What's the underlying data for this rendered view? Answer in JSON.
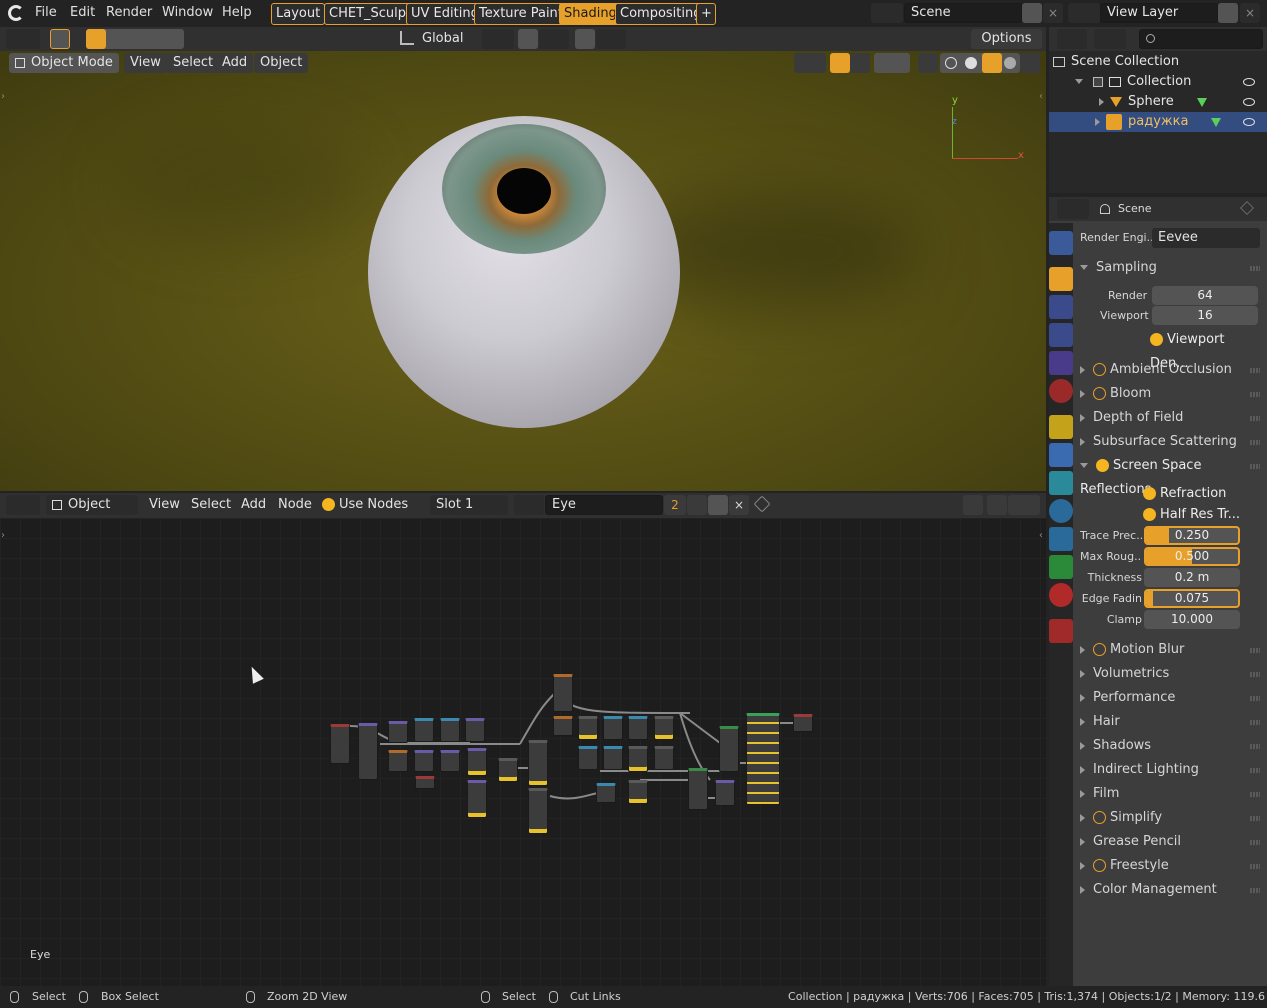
{
  "menus": [
    "File",
    "Edit",
    "Render",
    "Window",
    "Help"
  ],
  "workspaces": [
    {
      "label": "Layout"
    },
    {
      "label": "CHET_Sculpt"
    },
    {
      "label": "UV Editing"
    },
    {
      "label": "Texture Paint"
    },
    {
      "label": "Shading",
      "active": true
    },
    {
      "label": "Compositing"
    },
    {
      "label": "+"
    }
  ],
  "scene": {
    "name": "Scene"
  },
  "view_layer": {
    "name": "View Layer"
  },
  "viewport": {
    "transform_orientation": "Global",
    "options_label": "Options",
    "mode": "Object Mode",
    "menus": [
      "View",
      "Select",
      "Add",
      "Object"
    ],
    "gizmo": {
      "y": "y",
      "z": "z",
      "x": "x"
    }
  },
  "node_editor": {
    "type": "Object",
    "menus": [
      "View",
      "Select",
      "Add",
      "Node"
    ],
    "use_nodes_label": "Use Nodes",
    "slot": "Slot 1",
    "material": "Eye",
    "user_count": "2",
    "material_label": "Eye"
  },
  "outliner": {
    "root": "Scene Collection",
    "items": [
      {
        "label": "Collection"
      },
      {
        "label": "Sphere"
      },
      {
        "label": "радужка",
        "selected": true
      }
    ]
  },
  "properties": {
    "context": "Scene",
    "render_engine_label": "Render Engi...",
    "render_engine": "Eevee",
    "sampling": {
      "title": "Sampling",
      "render_label": "Render",
      "render": "64",
      "viewport_label": "Viewport",
      "viewport": "16",
      "denoise_label": "Viewport Den..."
    },
    "panels_a": [
      {
        "label": "Ambient Occlusion",
        "checkbox": true
      },
      {
        "label": "Bloom",
        "checkbox": true
      },
      {
        "label": "Depth of Field",
        "checkbox": false
      },
      {
        "label": "Subsurface Scattering",
        "checkbox": false
      }
    ],
    "ssr": {
      "title": "Screen Space Reflections",
      "refraction_label": "Refraction",
      "half_res_label": "Half Res Tr...",
      "fields": [
        {
          "label": "Trace Prec...",
          "value": "0.250",
          "fill": 0.25,
          "selected": true
        },
        {
          "label": "Max Roug...",
          "value": "0.500",
          "fill": 0.5,
          "selected": true
        },
        {
          "label": "Thickness",
          "value": "0.2 m",
          "fill": 0,
          "selected": false
        },
        {
          "label": "Edge Fadin",
          "value": "0.075",
          "fill": 0.075,
          "selected": true
        },
        {
          "label": "Clamp",
          "value": "10.000",
          "fill": 0,
          "selected": false
        }
      ]
    },
    "panels_b": [
      {
        "label": "Motion Blur",
        "checkbox": true
      },
      {
        "label": "Volumetrics",
        "checkbox": false
      },
      {
        "label": "Performance",
        "checkbox": false
      },
      {
        "label": "Hair",
        "checkbox": false
      },
      {
        "label": "Shadows",
        "checkbox": false
      },
      {
        "label": "Indirect Lighting",
        "checkbox": false
      },
      {
        "label": "Film",
        "checkbox": false
      },
      {
        "label": "Simplify",
        "checkbox": true
      },
      {
        "label": "Grease Pencil",
        "checkbox": false
      },
      {
        "label": "Freestyle",
        "checkbox": true
      },
      {
        "label": "Color Management",
        "checkbox": false
      }
    ]
  },
  "statusbar": {
    "select": "Select",
    "box_select": "Box Select",
    "zoom": "Zoom 2D View",
    "select2": "Select",
    "cut_links": "Cut Links",
    "stats": "Collection | радужка | Verts:706 | Faces:705 | Tris:1,374 | Objects:1/2 | Memory: 119.6"
  },
  "colors": {
    "accent": "#e7a02a",
    "selected_row": "#334d80",
    "header": "#303030",
    "panel": "#3d3d3d"
  }
}
